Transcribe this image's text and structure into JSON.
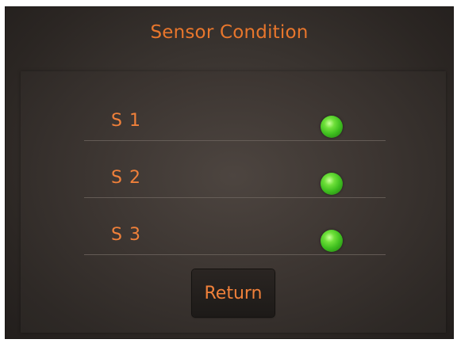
{
  "header": {
    "title": "Sensor Condition"
  },
  "sensors": [
    {
      "label": "S 1",
      "status_color": "#3fbf1f",
      "indicator": "green-led"
    },
    {
      "label": "S 2",
      "status_color": "#3fbf1f",
      "indicator": "green-led"
    },
    {
      "label": "S 3",
      "status_color": "#3fbf1f",
      "indicator": "green-led"
    }
  ],
  "actions": {
    "return_label": "Return"
  },
  "theme": {
    "accent": "#e8762c",
    "background": "#2b2623",
    "ok": "#3fbf1f"
  }
}
